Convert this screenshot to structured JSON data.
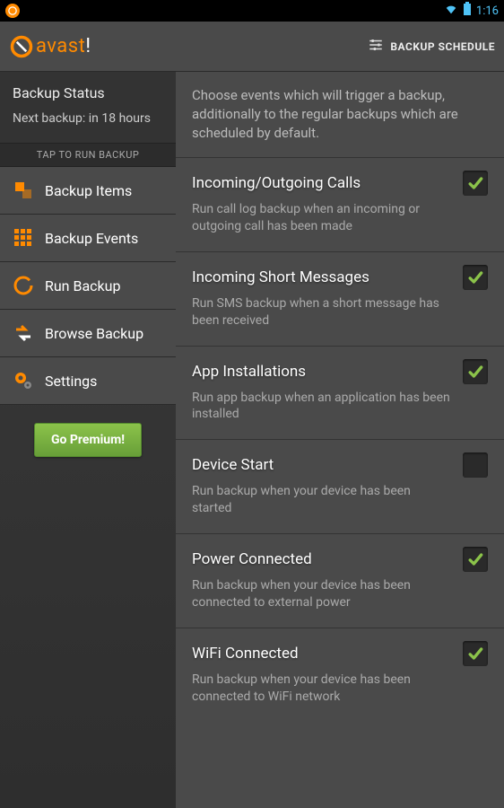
{
  "status_bar": {
    "time": "1:16"
  },
  "app_bar": {
    "logo_text_prefix": "avast",
    "logo_text_suffix": "!",
    "action_label": "BACKUP SCHEDULE"
  },
  "sidebar": {
    "status_title": "Backup Status",
    "next_backup": "Next backup: in 18 hours",
    "tap_label": "TAP TO RUN BACKUP",
    "items": [
      {
        "label": "Backup Items",
        "icon": "backup-items"
      },
      {
        "label": "Backup Events",
        "icon": "backup-events"
      },
      {
        "label": "Run Backup",
        "icon": "run-backup"
      },
      {
        "label": "Browse Backup",
        "icon": "browse-backup"
      },
      {
        "label": "Settings",
        "icon": "settings"
      }
    ],
    "premium_label": "Go Premium!"
  },
  "content": {
    "intro": "Choose events which will trigger a backup, additionally to the regular backups which are scheduled by default.",
    "events": [
      {
        "title": "Incoming/Outgoing Calls",
        "desc": "Run call log backup when an incoming or outgoing call has been made",
        "checked": true
      },
      {
        "title": "Incoming Short Messages",
        "desc": "Run SMS backup when a short message has been received",
        "checked": true
      },
      {
        "title": "App Installations",
        "desc": "Run app backup when an application has been installed",
        "checked": true
      },
      {
        "title": "Device Start",
        "desc": "Run backup when your device has been started",
        "checked": false
      },
      {
        "title": "Power Connected",
        "desc": "Run backup when your device has been connected to external power",
        "checked": true
      },
      {
        "title": "WiFi Connected",
        "desc": "Run backup when your device has been connected to WiFi network",
        "checked": true
      }
    ]
  }
}
